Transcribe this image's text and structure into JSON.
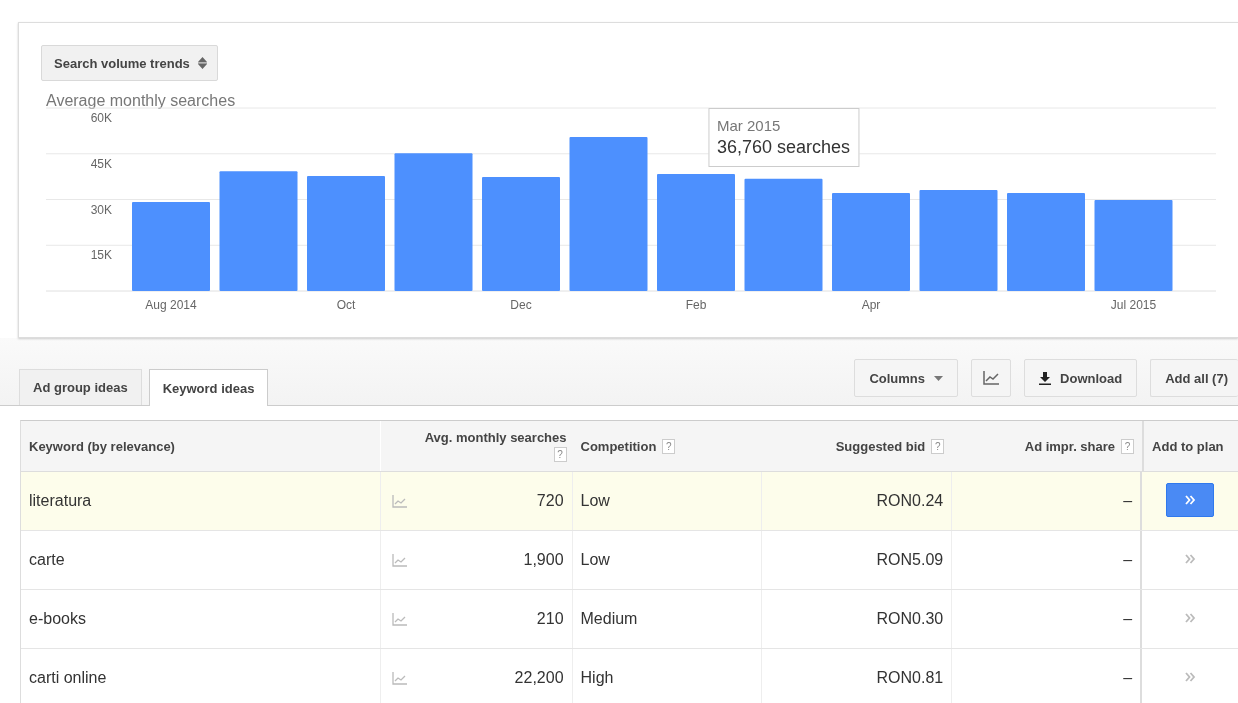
{
  "trend_selector": {
    "label": "Search volume trends"
  },
  "chart": {
    "chart_data": {
      "type": "bar",
      "title": "Average monthly searches",
      "categories": [
        "Aug 2014",
        null,
        "Oct",
        null,
        "Dec",
        null,
        "Feb",
        null,
        "Apr",
        null,
        null,
        "Jul 2015"
      ],
      "series": [
        {
          "color": "#4d90fe",
          "values": [
            29200,
            39300,
            37700,
            45200,
            37400,
            50500,
            38400,
            36800,
            32100,
            33100,
            32100,
            29800
          ]
        }
      ],
      "ylim": [
        0,
        60000
      ],
      "grid": true,
      "yticks": [
        {
          "value": 15000,
          "label": "15K"
        },
        {
          "value": 30000,
          "label": "30K"
        },
        {
          "value": 45000,
          "label": "45K"
        },
        {
          "value": 60000,
          "label": "60K"
        }
      ]
    },
    "tooltip": {
      "title": "Mar 2015",
      "value": "36,760 searches"
    }
  },
  "tabs": [
    {
      "label": "Ad group ideas",
      "selected": false
    },
    {
      "label": "Keyword ideas",
      "selected": true
    }
  ],
  "toolbar": {
    "columns": "Columns",
    "download": "Download",
    "add_all": "Add all (7)"
  },
  "table": {
    "columns": [
      {
        "label": "Keyword (by relevance)"
      },
      {
        "label": "Avg. monthly searches",
        "help": "?"
      },
      {
        "label": "Competition",
        "help": "?"
      },
      {
        "label": "Suggested bid",
        "help": "?"
      },
      {
        "label": "Ad impr. share",
        "help": "?"
      },
      {
        "label": "Add to plan"
      }
    ],
    "rows": [
      {
        "keyword": "literatura",
        "searches": "720",
        "competition": "Low",
        "bid": "RON0.24",
        "share": "–",
        "selected": true
      },
      {
        "keyword": "carte",
        "searches": "1,900",
        "competition": "Low",
        "bid": "RON5.09",
        "share": "–",
        "selected": false
      },
      {
        "keyword": "e-books",
        "searches": "210",
        "competition": "Medium",
        "bid": "RON0.30",
        "share": "–",
        "selected": false
      },
      {
        "keyword": "carti online",
        "searches": "22,200",
        "competition": "High",
        "bid": "RON0.81",
        "share": "–",
        "selected": false
      }
    ]
  }
}
